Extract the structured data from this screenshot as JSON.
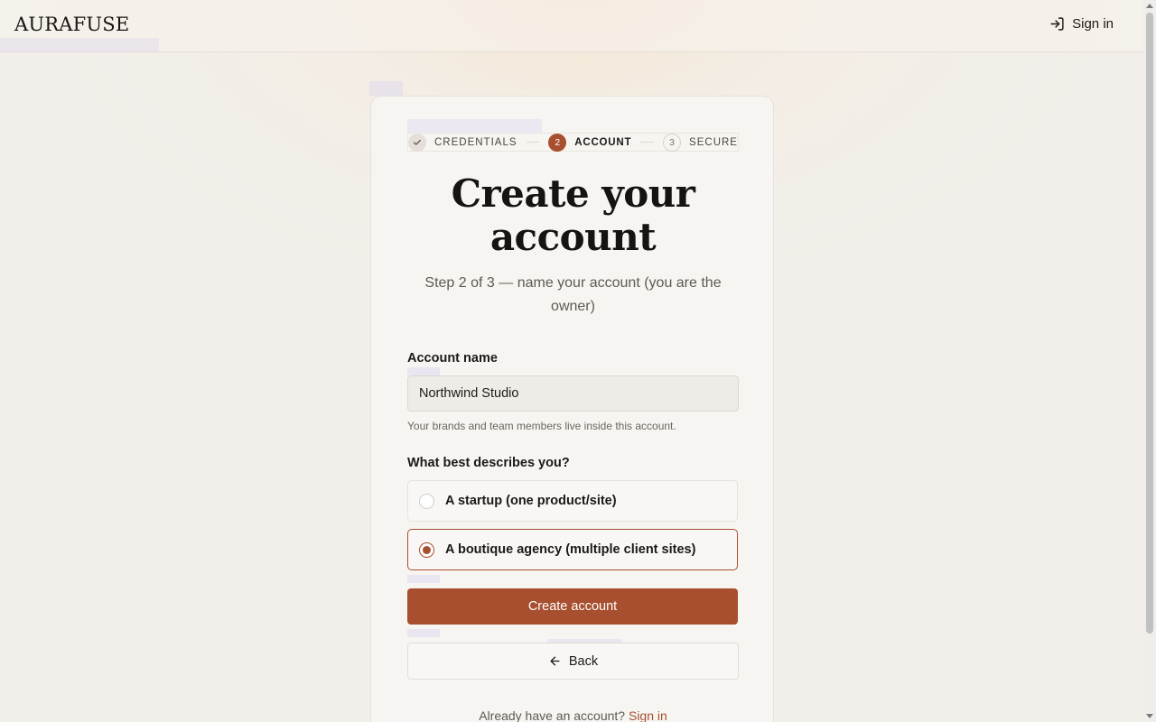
{
  "brand": {
    "logo_text": "AURAFUSE"
  },
  "header": {
    "signin_label": "Sign in",
    "signin_icon": "sign-in-icon"
  },
  "stepper": {
    "steps": [
      {
        "number": "✓",
        "label": "CREDENTIALS",
        "state": "done"
      },
      {
        "number": "2",
        "label": "ACCOUNT",
        "state": "active"
      },
      {
        "number": "3",
        "label": "SECURE",
        "state": "todo"
      }
    ]
  },
  "form": {
    "title": "Create your account",
    "subtitle": "Step 2 of 3 — name your account (you are the owner)",
    "account_name_label": "Account name",
    "account_name_value": "Northwind Studio",
    "account_name_hint": "Your brands and team members live inside this account.",
    "describe_label": "What best describes you?",
    "options": [
      {
        "label": "A startup (one product/site)",
        "selected": false
      },
      {
        "label": "A boutique agency (multiple client sites)",
        "selected": true
      }
    ],
    "submit_label": "Create account",
    "back_label": "Back"
  },
  "footer": {
    "prompt": "Already have an account?",
    "link": "Sign in"
  },
  "colors": {
    "accent": "#a84f2f",
    "background": "#f3efea",
    "card": "#f7f5f2"
  }
}
